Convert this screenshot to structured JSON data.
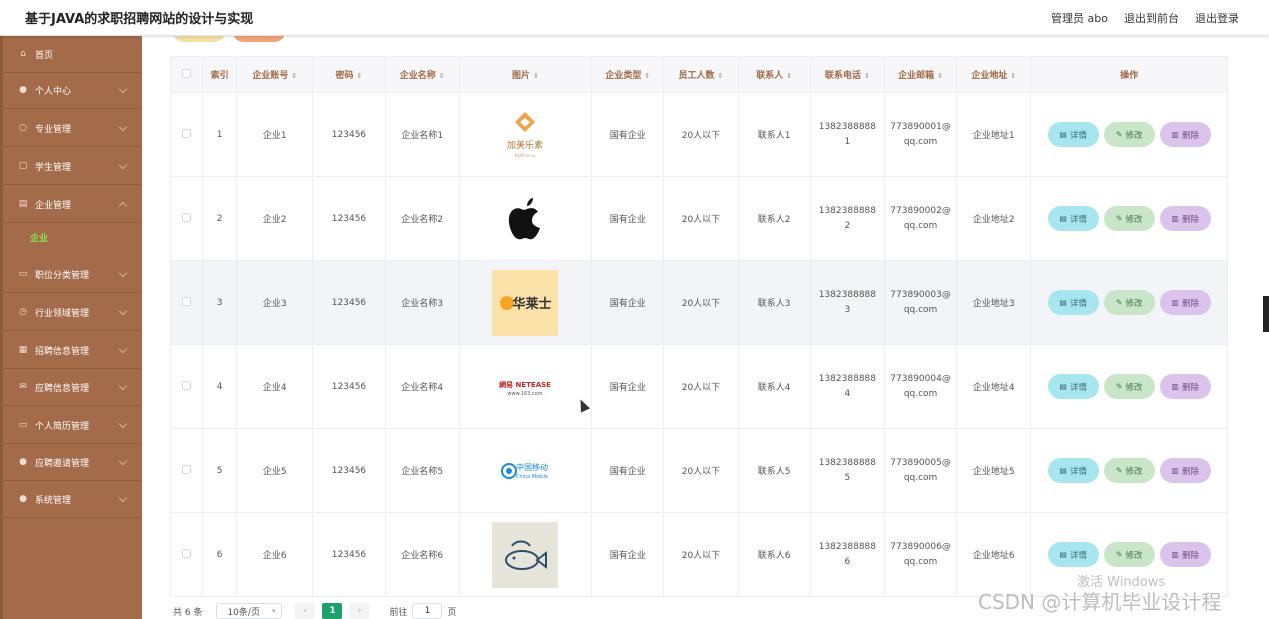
{
  "header": {
    "site_title": "基于JAVA的求职招聘网站的设计与实现",
    "admin_label": "管理员 abo",
    "front_label": "退出到前台",
    "logout_label": "退出登录"
  },
  "sidebar": {
    "items": [
      {
        "label": "首页",
        "icon": "home-icon",
        "glyph": "⌂"
      },
      {
        "label": "个人中心",
        "icon": "user-icon",
        "glyph": "●"
      },
      {
        "label": "专业管理",
        "icon": "circle-icon",
        "glyph": "○"
      },
      {
        "label": "学生管理",
        "icon": "doc-icon",
        "glyph": "▢"
      },
      {
        "label": "企业管理",
        "icon": "doc-icon",
        "glyph": "▤"
      },
      {
        "label": "职位分类管理",
        "icon": "chat-icon",
        "glyph": "▭"
      },
      {
        "label": "行业领域管理",
        "icon": "clock-icon",
        "glyph": "◷"
      },
      {
        "label": "招聘信息管理",
        "icon": "card-icon",
        "glyph": "▦"
      },
      {
        "label": "应聘信息管理",
        "icon": "mail-icon",
        "glyph": "✉"
      },
      {
        "label": "个人简历管理",
        "icon": "chat-icon",
        "glyph": "▭"
      },
      {
        "label": "应聘邀请管理",
        "icon": "pin-icon",
        "glyph": "●"
      },
      {
        "label": "系统管理",
        "icon": "user-icon",
        "glyph": "●"
      }
    ],
    "sub_item": "企业"
  },
  "table": {
    "headers": [
      "索引",
      "企业账号",
      "密码",
      "企业名称",
      "图片",
      "企业类型",
      "员工人数",
      "联系人",
      "联系电话",
      "企业邮箱",
      "企业地址",
      "操作"
    ],
    "rows": [
      {
        "index": "1",
        "account": "企业1",
        "password": "123456",
        "name": "企业名称1",
        "logo": "jiamei",
        "type": "国有企业",
        "staff": "20人以下",
        "contact": "联系人1",
        "phone_a": "1382388888",
        "phone_b": "1",
        "email_a": "773890001@",
        "email_b": "qq.com",
        "address": "企业地址1"
      },
      {
        "index": "2",
        "account": "企业2",
        "password": "123456",
        "name": "企业名称2",
        "logo": "apple",
        "type": "国有企业",
        "staff": "20人以下",
        "contact": "联系人2",
        "phone_a": "1382388888",
        "phone_b": "2",
        "email_a": "773890002@",
        "email_b": "qq.com",
        "address": "企业地址2"
      },
      {
        "index": "3",
        "account": "企业3",
        "password": "123456",
        "name": "企业名称3",
        "logo": "hualaishi",
        "type": "国有企业",
        "staff": "20人以下",
        "contact": "联系人3",
        "phone_a": "1382388888",
        "phone_b": "3",
        "email_a": "773890003@",
        "email_b": "qq.com",
        "address": "企业地址3"
      },
      {
        "index": "4",
        "account": "企业4",
        "password": "123456",
        "name": "企业名称4",
        "logo": "netease",
        "type": "国有企业",
        "staff": "20人以下",
        "contact": "联系人4",
        "phone_a": "1382388888",
        "phone_b": "4",
        "email_a": "773890004@",
        "email_b": "qq.com",
        "address": "企业地址4"
      },
      {
        "index": "5",
        "account": "企业5",
        "password": "123456",
        "name": "企业名称5",
        "logo": "chinamobile",
        "type": "国有企业",
        "staff": "20人以下",
        "contact": "联系人5",
        "phone_a": "1382388888",
        "phone_b": "5",
        "email_a": "773890005@",
        "email_b": "qq.com",
        "address": "企业地址5"
      },
      {
        "index": "6",
        "account": "企业6",
        "password": "123456",
        "name": "企业名称6",
        "logo": "fish",
        "type": "国有企业",
        "staff": "20人以下",
        "contact": "联系人6",
        "phone_a": "1382388888",
        "phone_b": "6",
        "email_a": "773890006@",
        "email_b": "qq.com",
        "address": "企业地址6"
      }
    ],
    "actions": {
      "detail": "详情",
      "edit": "修改",
      "delete": "删除"
    }
  },
  "logos": {
    "jiamei_text": "加美乐素",
    "jiamei_sub": "KAMI·le·su",
    "hualaishi_text": "华莱士",
    "netease_top": "網易 NETEASE",
    "netease_bottom": "www.163.com",
    "chinamobile_cn": "中国移动",
    "chinamobile_en": "China Mobile"
  },
  "pagination": {
    "total": "共 6 条",
    "page_size": "10条/页",
    "current_page": "1",
    "goto_label": "前往",
    "goto_value": "1",
    "page_suffix": "页"
  },
  "watermarks": {
    "windows": "激活 Windows",
    "csdn": "CSDN @计算机毕业设计程"
  },
  "colors": {
    "sidebar": "#a46b4a",
    "accent_green": "#1ea26d",
    "header_text": "#a06a46"
  }
}
